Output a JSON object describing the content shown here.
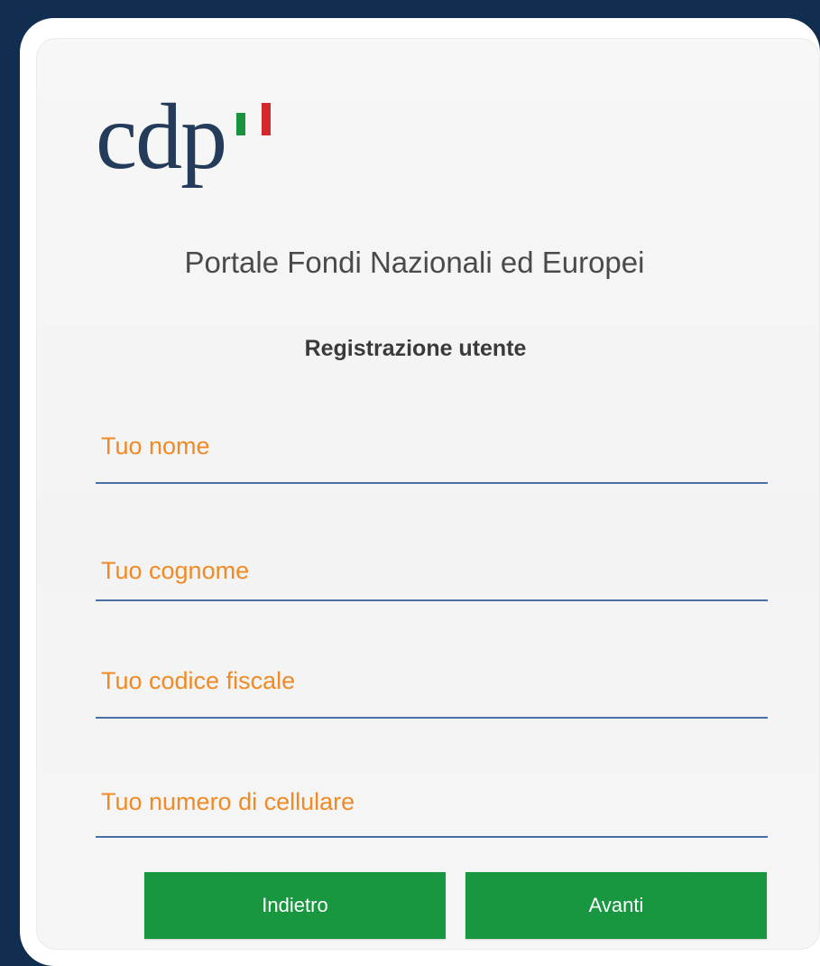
{
  "brand": {
    "logo_text": "cdp",
    "flag_colors": [
      "#19933f",
      "#ffffff",
      "#d3282c"
    ]
  },
  "header": {
    "title": "Portale Fondi Nazionali ed Europei",
    "subtitle": "Registrazione utente"
  },
  "form": {
    "name_placeholder": "Tuo nome",
    "surname_placeholder": "Tuo cognome",
    "tax_code_placeholder": "Tuo codice fiscale",
    "phone_placeholder": "Tuo numero di cellulare"
  },
  "actions": {
    "back_label": "Indietro",
    "next_label": "Avanti"
  },
  "colors": {
    "background": "#112d4f",
    "accent_placeholder": "#f08a24",
    "button": "#199740",
    "underline": "#4c6ea8"
  }
}
